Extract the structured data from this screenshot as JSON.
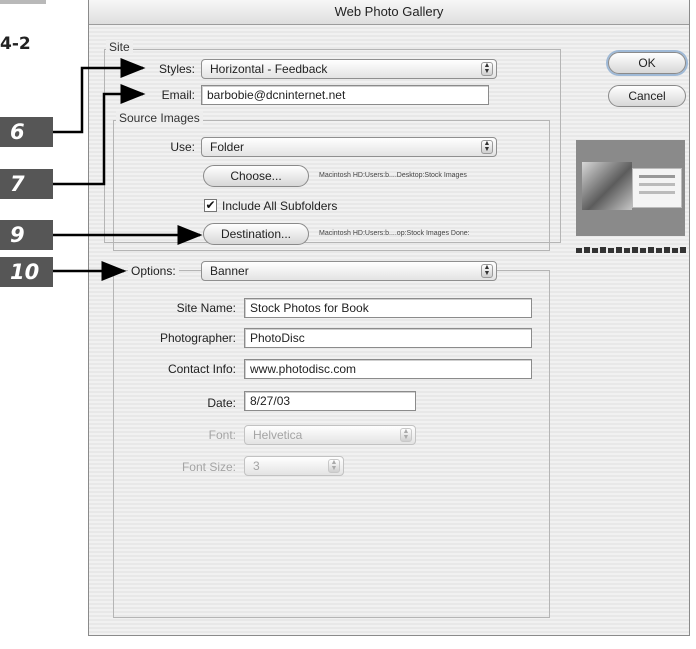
{
  "figure": {
    "number": "4-2"
  },
  "dialog": {
    "title": "Web Photo Gallery"
  },
  "site": {
    "group_label": "Site",
    "styles_label": "Styles:",
    "styles_value": "Horizontal - Feedback",
    "email_label": "Email:",
    "email_value": "barbobie@dcninternet.net"
  },
  "source_images": {
    "group_label": "Source Images",
    "use_label": "Use:",
    "use_value": "Folder",
    "choose_button": "Choose...",
    "choose_path": "Macintosh HD:Users:b....Desktop:Stock Images",
    "include_subfolders_label": "Include All Subfolders",
    "include_subfolders_checked": true,
    "destination_button": "Destination...",
    "destination_path": "Macintosh HD:Users:b....op:Stock Images Done:"
  },
  "options": {
    "label": "Options:",
    "value": "Banner",
    "site_name_label": "Site Name:",
    "site_name_value": "Stock Photos for Book",
    "photographer_label": "Photographer:",
    "photographer_value": "PhotoDisc",
    "contact_label": "Contact Info:",
    "contact_value": "www.photodisc.com",
    "date_label": "Date:",
    "date_value": "8/27/03",
    "font_label": "Font:",
    "font_value": "Helvetica",
    "font_size_label": "Font Size:",
    "font_size_value": "3"
  },
  "buttons": {
    "ok": "OK",
    "cancel": "Cancel"
  },
  "callouts": [
    "6",
    "7",
    "9",
    "10"
  ],
  "colors": {
    "callout_bg": "#565656",
    "accent": "#000000"
  }
}
